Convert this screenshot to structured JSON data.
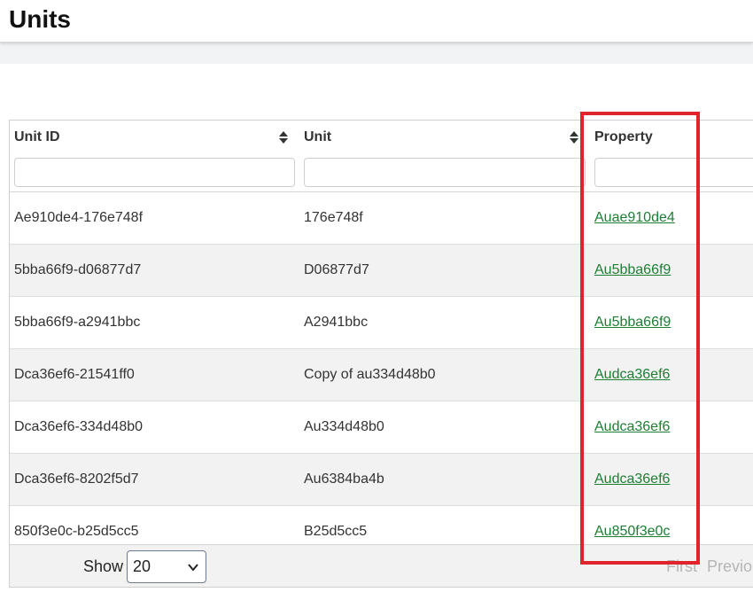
{
  "page": {
    "title": "Units"
  },
  "table": {
    "columns": [
      {
        "label": "Unit ID",
        "sortable": true
      },
      {
        "label": "Unit",
        "sortable": true
      },
      {
        "label": "Property",
        "sortable": false
      }
    ],
    "filters": {
      "unit_id_value": "",
      "unit_value": "",
      "property_value": ""
    },
    "rows": [
      {
        "unit_id": "Ae910de4-176e748f",
        "unit": "176e748f",
        "property": "Auae910de4"
      },
      {
        "unit_id": "5bba66f9-d06877d7",
        "unit": "D06877d7",
        "property": "Au5bba66f9"
      },
      {
        "unit_id": "5bba66f9-a2941bbc",
        "unit": "A2941bbc",
        "property": "Au5bba66f9"
      },
      {
        "unit_id": "Dca36ef6-21541ff0",
        "unit": "Copy of au334d48b0",
        "property": "Audca36ef6"
      },
      {
        "unit_id": "Dca36ef6-334d48b0",
        "unit": "Au334d48b0",
        "property": "Audca36ef6"
      },
      {
        "unit_id": "Dca36ef6-8202f5d7",
        "unit": "Au6384ba4b",
        "property": "Audca36ef6"
      },
      {
        "unit_id": "850f3e0c-b25d5cc5",
        "unit": "B25d5cc5",
        "property": "Au850f3e0c"
      }
    ]
  },
  "footer": {
    "show_label": "Show",
    "page_size": "20",
    "first_label": "First",
    "previous_label": "Previous"
  },
  "colors": {
    "link": "#1e7e34",
    "highlight": "#e0242b",
    "row_alt": "#f2f2f2"
  },
  "icons": {
    "sort": "sort-icon",
    "select": "chevron-down-icon"
  }
}
